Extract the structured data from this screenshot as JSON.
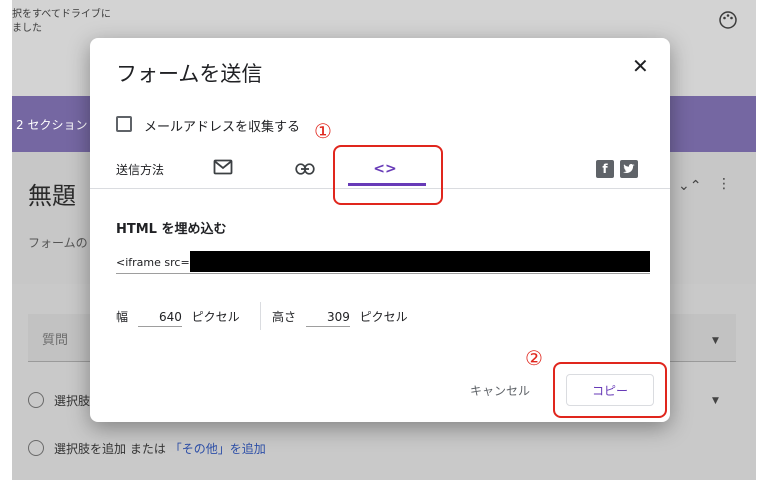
{
  "background": {
    "notice_line1": "択をすべてドライブに",
    "notice_line2": "ました",
    "section_label": "2 セクション",
    "title_fragment": "無題",
    "description_fragment": "フォームの",
    "question_placeholder": "質問",
    "option_fragment": "選択肢",
    "add_option": "選択肢を追加",
    "or_text": "または",
    "add_other": "「その他」を追加"
  },
  "dialog": {
    "title": "フォームを送信",
    "collect_email_label": "メールアドレスを収集する",
    "collect_email_checked": false,
    "send_method_label": "送信方法",
    "tabs": [
      {
        "name": "email",
        "icon": "mail-icon"
      },
      {
        "name": "link",
        "icon": "link-icon"
      },
      {
        "name": "embed",
        "icon": "code-icon",
        "symbol": "<>",
        "active": true
      }
    ],
    "embed_heading": "HTML を埋め込む",
    "embed_code_prefix": "<iframe src=",
    "width_label": "幅",
    "width_value": "640",
    "height_label": "高さ",
    "height_value": "309",
    "unit_label": "ピクセル",
    "cancel_label": "キャンセル",
    "copy_label": "コピー",
    "accent_color": "#673ab7"
  },
  "annotations": {
    "marker1": "①",
    "marker2": "②",
    "color": "#e0261d"
  }
}
